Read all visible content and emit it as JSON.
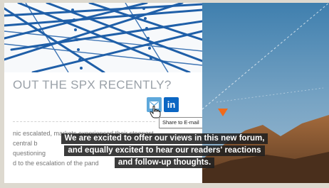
{
  "article": {
    "headline": "OUT THE SPX RECENTLY?",
    "body_lines": [
      "nic escalated, markets experienced their steepest",
      "central b",
      "questioning",
      "d to the escalation of the pand"
    ]
  },
  "share": {
    "email_icon": "email-icon",
    "linkedin_label": "in",
    "tooltip": "Share to E-mail"
  },
  "captions": [
    "We are excited to offer our views in this new forum,",
    "and equally excited to hear our readers' reactions",
    "and follow-up thoughts."
  ],
  "colors": {
    "email_button": "#5ea8db",
    "linkedin_button": "#0b66c3",
    "caption_background": "#202020"
  }
}
